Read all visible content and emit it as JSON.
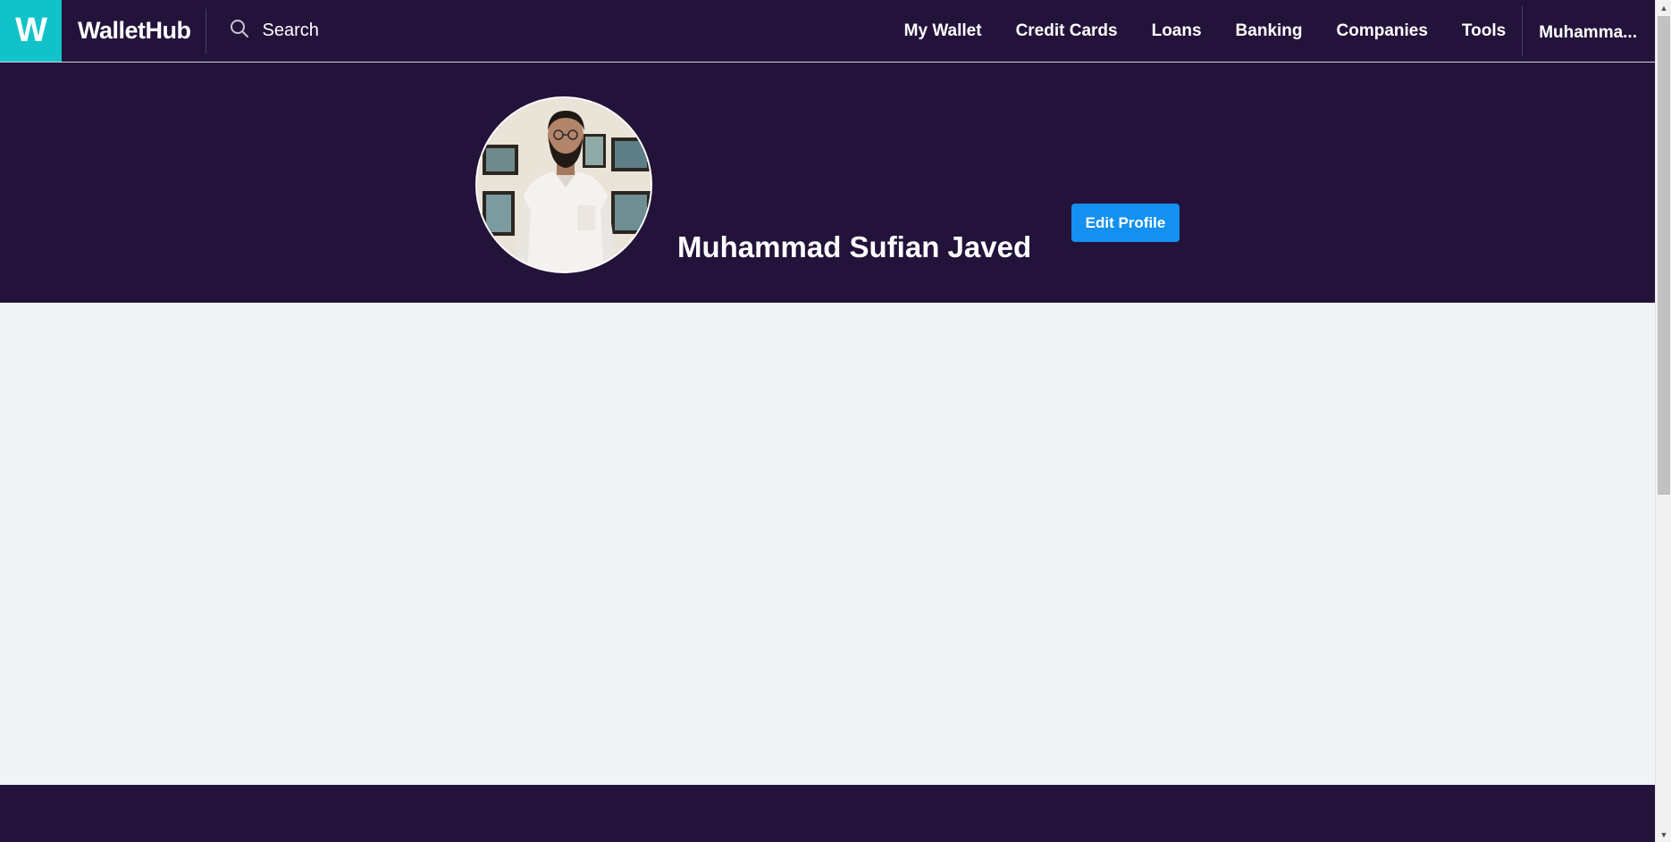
{
  "header": {
    "logo_letter": "W",
    "brand_name": "WalletHub",
    "search_label": "Search",
    "nav_items": [
      "My Wallet",
      "Credit Cards",
      "Loans",
      "Banking",
      "Companies",
      "Tools"
    ],
    "user_menu_label": "Muhamma..."
  },
  "profile": {
    "name": "Muhammad Sufian Javed",
    "edit_button_label": "Edit Profile"
  },
  "colors": {
    "header_background": "#23133a",
    "logo_accent": "#11c3c9",
    "primary_button": "#1390f0",
    "page_background": "#f0f4f7"
  },
  "icons": {
    "search": "search-icon",
    "avatar": "user-avatar-photo",
    "scroll_up": "scroll-up-arrow-icon",
    "scroll_down": "scroll-down-arrow-icon"
  }
}
